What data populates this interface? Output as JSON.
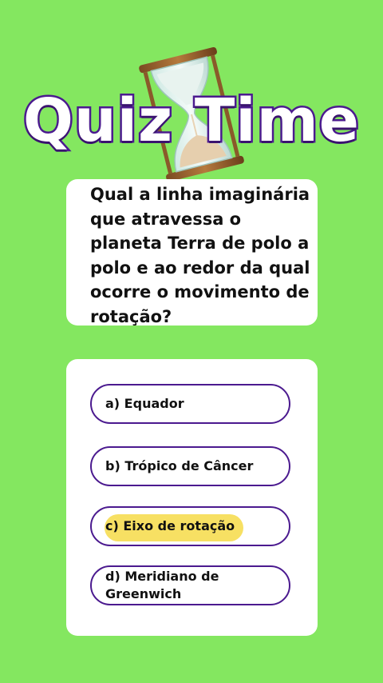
{
  "header": {
    "title": "Quiz Time"
  },
  "question": {
    "text": "Qual a linha imaginária que atravessa o planeta Terra de polo a polo e ao redor da qual ocorre o movimento de rotação?"
  },
  "options": [
    {
      "label": "a) Equador"
    },
    {
      "label": "b) Trópico de Câncer"
    },
    {
      "label": "c) Eixo de rotação",
      "highlighted": true
    },
    {
      "label": "d) Meridiano de Greenwich"
    }
  ],
  "colors": {
    "background": "#84e760",
    "accent": "#4b1a8f",
    "highlight": "#f7e063"
  },
  "icons": {
    "hourglass": "hourglass-icon"
  }
}
